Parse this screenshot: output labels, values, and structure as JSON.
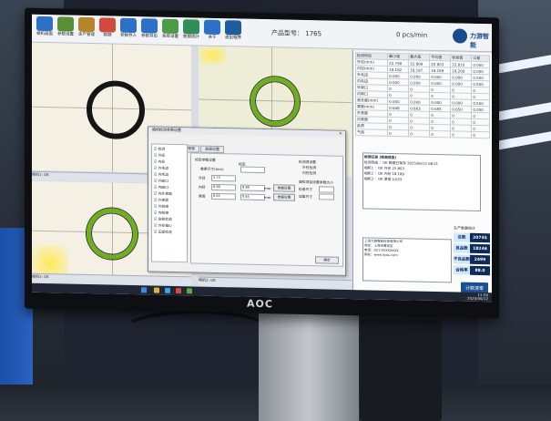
{
  "app": {
    "product_label": "产品型号：",
    "product_value": "1765",
    "count_value": "0 pcs/min",
    "logo_text": "力游智能",
    "toolbar": [
      {
        "label": "相机画面",
        "color": "#2c71c6"
      },
      {
        "label": "参数设置",
        "color": "#5a8f38"
      },
      {
        "label": "生产管理",
        "color": "#b8862a"
      },
      {
        "label": "数据",
        "color": "#d24a3d"
      },
      {
        "label": "参数导入",
        "color": "#2c71c6"
      },
      {
        "label": "参数导出",
        "color": "#2c71c6"
      },
      {
        "label": "系统设置",
        "color": "#4b9b47"
      },
      {
        "label": "数据统计",
        "color": "#2f8f5a"
      },
      {
        "label": "关于",
        "color": "#2c71c6"
      },
      {
        "label": "退出程序",
        "color": "#1f5d9f"
      }
    ]
  },
  "dialog": {
    "title": "相机检测参数设置",
    "close": "×",
    "tabs": [
      "检测项目设置",
      "常规",
      "高级设置"
    ],
    "tree": [
      "检测",
      "外径",
      "内径",
      "外毛边",
      "内毛边",
      "外缺口",
      "内缺口",
      "内外表面",
      "外表面",
      "外粉接",
      "内粉接",
      "杂质检测",
      "外径偏心",
      "正面检测"
    ],
    "subtabs": [
      "检测结构",
      "外径",
      "内径",
      "缺陷",
      "外毛刺",
      "内毛刺"
    ],
    "sections": {
      "group1": "标定参数设置",
      "scale": "像素尺寸(mm)",
      "left_labels": [
        "外径",
        "内径",
        "厚度"
      ],
      "values": [
        "5.75",
        "0.90",
        "0.65"
      ],
      "unit": "mm",
      "buttons": [
        "数据设置",
        "数据设置"
      ],
      "mid_label": "标定",
      "right_title": "检测项设置",
      "right_labels": [
        "外径检测",
        "内径检测"
      ],
      "right_title2": "面检项目设置参数大小",
      "right_rows": [
        "检查尺寸",
        "误差尺寸"
      ],
      "ok": "确定"
    }
  },
  "results": {
    "headers": [
      "检测项目",
      "最小值",
      "最大值",
      "平均值",
      "标准值",
      "公差"
    ],
    "rows": [
      [
        "外径(mm)",
        "22.798",
        "22.809",
        "22.803",
        "22.810",
        "0.050"
      ],
      [
        "内径(mm)",
        "18.182",
        "18.197",
        "18.189",
        "18.200",
        "0.050"
      ],
      [
        "外毛边",
        "0.000",
        "0.000",
        "0.000",
        "0.000",
        "0.500"
      ],
      [
        "内毛边",
        "0.000",
        "0.000",
        "0.000",
        "0.000",
        "0.500"
      ],
      [
        "外缺口",
        "0",
        "0",
        "0",
        "0",
        "0"
      ],
      [
        "内缺口",
        "0",
        "0",
        "0",
        "0",
        "0"
      ],
      [
        "周长度(mm)",
        "0.000",
        "0.000",
        "0.000",
        "0.000",
        "0.500"
      ],
      [
        "厚度(mm)",
        "0.648",
        "0.663",
        "0.655",
        "0.650",
        "0.050"
      ],
      [
        "外表面",
        "0",
        "0",
        "0",
        "0",
        "0"
      ],
      [
        "内表面",
        "0",
        "0",
        "0",
        "0",
        "0"
      ],
      [
        "杂质",
        "0",
        "0",
        "0",
        "0",
        "0"
      ],
      [
        "气泡",
        "0",
        "0",
        "0",
        "0",
        "0"
      ]
    ],
    "log_title": "检测记录 (检测信息)",
    "log_lines": [
      "检测完成 ：OK 数据已保存 2025/06/12 08:21",
      "相机1 ：OK  外径 22.803",
      "相机2 ：OK  内径 18.189",
      "相机3 ：OK  厚度 0.655"
    ],
    "info_lines": [
      "上海力游智能科技有限公司",
      "地址：上海市嘉定区",
      "电话：021-XXXXXXXX",
      "网址：www.liyou.com"
    ],
    "stats_title": "生产数量统计",
    "stats": [
      {
        "label": "总数",
        "value": "20745"
      },
      {
        "label": "良品数",
        "value": "18246"
      },
      {
        "label": "不良品数",
        "value": "2499"
      },
      {
        "label": "合格率",
        "value": "88.0"
      }
    ],
    "reset": "计数清零"
  },
  "cams": [
    {
      "status": "相机1: OK"
    },
    {
      "status": "相机2: OK"
    },
    {
      "status": "相机3: OK"
    }
  ],
  "taskbar": {
    "time": "11:56",
    "date": "2025/06/12"
  },
  "monitor_brand": "AOC",
  "colors": {
    "ring_black": "#151515",
    "ring_green": "#6fae1f",
    "panel_blue": "#0d2b57"
  }
}
